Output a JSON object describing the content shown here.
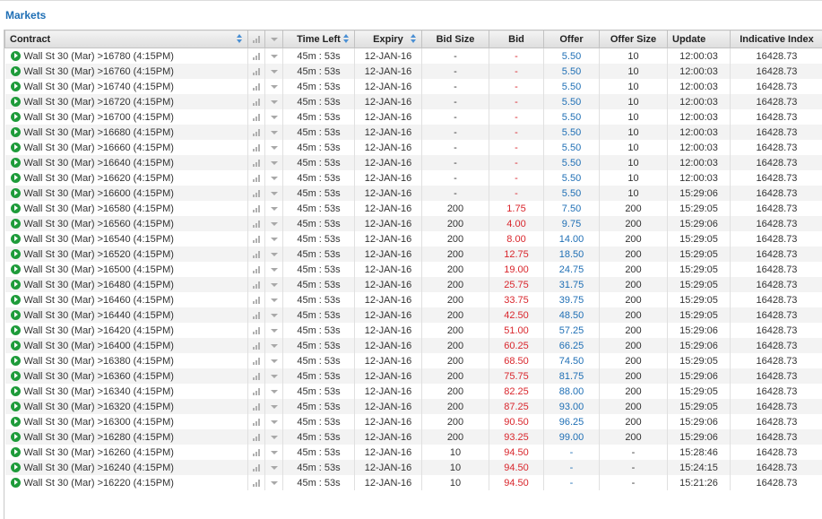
{
  "panel": {
    "title": "Markets"
  },
  "columns": {
    "contract": "Contract",
    "time_left": "Time Left",
    "expiry": "Expiry",
    "bid_size": "Bid Size",
    "bid": "Bid",
    "offer": "Offer",
    "offer_size": "Offer Size",
    "update": "Update",
    "indicative_index": "Indicative Index"
  },
  "colors": {
    "bid": "#d9262c",
    "offer": "#1f6fb5",
    "play": "#1e9b3a",
    "header_link": "#1f6fb5"
  },
  "rows": [
    {
      "contract": "Wall St 30 (Mar) >16780 (4:15PM)",
      "time_left": "45m : 53s",
      "expiry": "12-JAN-16",
      "bid_size": "-",
      "bid": "-",
      "offer": "5.50",
      "offer_size": "10",
      "update": "12:00:03",
      "index": "16428.73"
    },
    {
      "contract": "Wall St 30 (Mar) >16760 (4:15PM)",
      "time_left": "45m : 53s",
      "expiry": "12-JAN-16",
      "bid_size": "-",
      "bid": "-",
      "offer": "5.50",
      "offer_size": "10",
      "update": "12:00:03",
      "index": "16428.73"
    },
    {
      "contract": "Wall St 30 (Mar) >16740 (4:15PM)",
      "time_left": "45m : 53s",
      "expiry": "12-JAN-16",
      "bid_size": "-",
      "bid": "-",
      "offer": "5.50",
      "offer_size": "10",
      "update": "12:00:03",
      "index": "16428.73"
    },
    {
      "contract": "Wall St 30 (Mar) >16720 (4:15PM)",
      "time_left": "45m : 53s",
      "expiry": "12-JAN-16",
      "bid_size": "-",
      "bid": "-",
      "offer": "5.50",
      "offer_size": "10",
      "update": "12:00:03",
      "index": "16428.73"
    },
    {
      "contract": "Wall St 30 (Mar) >16700 (4:15PM)",
      "time_left": "45m : 53s",
      "expiry": "12-JAN-16",
      "bid_size": "-",
      "bid": "-",
      "offer": "5.50",
      "offer_size": "10",
      "update": "12:00:03",
      "index": "16428.73"
    },
    {
      "contract": "Wall St 30 (Mar) >16680 (4:15PM)",
      "time_left": "45m : 53s",
      "expiry": "12-JAN-16",
      "bid_size": "-",
      "bid": "-",
      "offer": "5.50",
      "offer_size": "10",
      "update": "12:00:03",
      "index": "16428.73"
    },
    {
      "contract": "Wall St 30 (Mar) >16660 (4:15PM)",
      "time_left": "45m : 53s",
      "expiry": "12-JAN-16",
      "bid_size": "-",
      "bid": "-",
      "offer": "5.50",
      "offer_size": "10",
      "update": "12:00:03",
      "index": "16428.73"
    },
    {
      "contract": "Wall St 30 (Mar) >16640 (4:15PM)",
      "time_left": "45m : 53s",
      "expiry": "12-JAN-16",
      "bid_size": "-",
      "bid": "-",
      "offer": "5.50",
      "offer_size": "10",
      "update": "12:00:03",
      "index": "16428.73"
    },
    {
      "contract": "Wall St 30 (Mar) >16620 (4:15PM)",
      "time_left": "45m : 53s",
      "expiry": "12-JAN-16",
      "bid_size": "-",
      "bid": "-",
      "offer": "5.50",
      "offer_size": "10",
      "update": "12:00:03",
      "index": "16428.73"
    },
    {
      "contract": "Wall St 30 (Mar) >16600 (4:15PM)",
      "time_left": "45m : 53s",
      "expiry": "12-JAN-16",
      "bid_size": "-",
      "bid": "-",
      "offer": "5.50",
      "offer_size": "10",
      "update": "15:29:06",
      "index": "16428.73"
    },
    {
      "contract": "Wall St 30 (Mar) >16580 (4:15PM)",
      "time_left": "45m : 53s",
      "expiry": "12-JAN-16",
      "bid_size": "200",
      "bid": "1.75",
      "offer": "7.50",
      "offer_size": "200",
      "update": "15:29:05",
      "index": "16428.73"
    },
    {
      "contract": "Wall St 30 (Mar) >16560 (4:15PM)",
      "time_left": "45m : 53s",
      "expiry": "12-JAN-16",
      "bid_size": "200",
      "bid": "4.00",
      "offer": "9.75",
      "offer_size": "200",
      "update": "15:29:06",
      "index": "16428.73"
    },
    {
      "contract": "Wall St 30 (Mar) >16540 (4:15PM)",
      "time_left": "45m : 53s",
      "expiry": "12-JAN-16",
      "bid_size": "200",
      "bid": "8.00",
      "offer": "14.00",
      "offer_size": "200",
      "update": "15:29:05",
      "index": "16428.73"
    },
    {
      "contract": "Wall St 30 (Mar) >16520 (4:15PM)",
      "time_left": "45m : 53s",
      "expiry": "12-JAN-16",
      "bid_size": "200",
      "bid": "12.75",
      "offer": "18.50",
      "offer_size": "200",
      "update": "15:29:05",
      "index": "16428.73"
    },
    {
      "contract": "Wall St 30 (Mar) >16500 (4:15PM)",
      "time_left": "45m : 53s",
      "expiry": "12-JAN-16",
      "bid_size": "200",
      "bid": "19.00",
      "offer": "24.75",
      "offer_size": "200",
      "update": "15:29:05",
      "index": "16428.73"
    },
    {
      "contract": "Wall St 30 (Mar) >16480 (4:15PM)",
      "time_left": "45m : 53s",
      "expiry": "12-JAN-16",
      "bid_size": "200",
      "bid": "25.75",
      "offer": "31.75",
      "offer_size": "200",
      "update": "15:29:05",
      "index": "16428.73"
    },
    {
      "contract": "Wall St 30 (Mar) >16460 (4:15PM)",
      "time_left": "45m : 53s",
      "expiry": "12-JAN-16",
      "bid_size": "200",
      "bid": "33.75",
      "offer": "39.75",
      "offer_size": "200",
      "update": "15:29:05",
      "index": "16428.73"
    },
    {
      "contract": "Wall St 30 (Mar) >16440 (4:15PM)",
      "time_left": "45m : 53s",
      "expiry": "12-JAN-16",
      "bid_size": "200",
      "bid": "42.50",
      "offer": "48.50",
      "offer_size": "200",
      "update": "15:29:05",
      "index": "16428.73"
    },
    {
      "contract": "Wall St 30 (Mar) >16420 (4:15PM)",
      "time_left": "45m : 53s",
      "expiry": "12-JAN-16",
      "bid_size": "200",
      "bid": "51.00",
      "offer": "57.25",
      "offer_size": "200",
      "update": "15:29:06",
      "index": "16428.73"
    },
    {
      "contract": "Wall St 30 (Mar) >16400 (4:15PM)",
      "time_left": "45m : 53s",
      "expiry": "12-JAN-16",
      "bid_size": "200",
      "bid": "60.25",
      "offer": "66.25",
      "offer_size": "200",
      "update": "15:29:06",
      "index": "16428.73"
    },
    {
      "contract": "Wall St 30 (Mar) >16380 (4:15PM)",
      "time_left": "45m : 53s",
      "expiry": "12-JAN-16",
      "bid_size": "200",
      "bid": "68.50",
      "offer": "74.50",
      "offer_size": "200",
      "update": "15:29:05",
      "index": "16428.73"
    },
    {
      "contract": "Wall St 30 (Mar) >16360 (4:15PM)",
      "time_left": "45m : 53s",
      "expiry": "12-JAN-16",
      "bid_size": "200",
      "bid": "75.75",
      "offer": "81.75",
      "offer_size": "200",
      "update": "15:29:06",
      "index": "16428.73"
    },
    {
      "contract": "Wall St 30 (Mar) >16340 (4:15PM)",
      "time_left": "45m : 53s",
      "expiry": "12-JAN-16",
      "bid_size": "200",
      "bid": "82.25",
      "offer": "88.00",
      "offer_size": "200",
      "update": "15:29:05",
      "index": "16428.73"
    },
    {
      "contract": "Wall St 30 (Mar) >16320 (4:15PM)",
      "time_left": "45m : 53s",
      "expiry": "12-JAN-16",
      "bid_size": "200",
      "bid": "87.25",
      "offer": "93.00",
      "offer_size": "200",
      "update": "15:29:05",
      "index": "16428.73"
    },
    {
      "contract": "Wall St 30 (Mar) >16300 (4:15PM)",
      "time_left": "45m : 53s",
      "expiry": "12-JAN-16",
      "bid_size": "200",
      "bid": "90.50",
      "offer": "96.25",
      "offer_size": "200",
      "update": "15:29:06",
      "index": "16428.73"
    },
    {
      "contract": "Wall St 30 (Mar) >16280 (4:15PM)",
      "time_left": "45m : 53s",
      "expiry": "12-JAN-16",
      "bid_size": "200",
      "bid": "93.25",
      "offer": "99.00",
      "offer_size": "200",
      "update": "15:29:06",
      "index": "16428.73"
    },
    {
      "contract": "Wall St 30 (Mar) >16260 (4:15PM)",
      "time_left": "45m : 53s",
      "expiry": "12-JAN-16",
      "bid_size": "10",
      "bid": "94.50",
      "offer": "-",
      "offer_size": "-",
      "update": "15:28:46",
      "index": "16428.73"
    },
    {
      "contract": "Wall St 30 (Mar) >16240 (4:15PM)",
      "time_left": "45m : 53s",
      "expiry": "12-JAN-16",
      "bid_size": "10",
      "bid": "94.50",
      "offer": "-",
      "offer_size": "-",
      "update": "15:24:15",
      "index": "16428.73"
    },
    {
      "contract": "Wall St 30 (Mar) >16220 (4:15PM)",
      "time_left": "45m : 53s",
      "expiry": "12-JAN-16",
      "bid_size": "10",
      "bid": "94.50",
      "offer": "-",
      "offer_size": "-",
      "update": "15:21:26",
      "index": "16428.73"
    }
  ]
}
